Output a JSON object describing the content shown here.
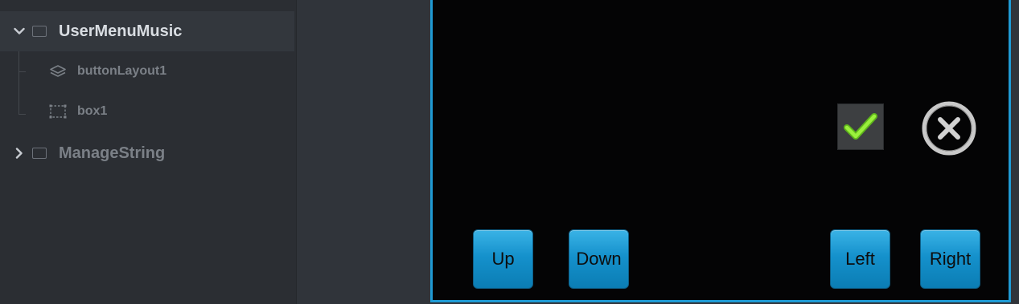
{
  "tree": {
    "items": [
      {
        "label": "UserMenuMusic",
        "expanded": true,
        "selected": true,
        "icon": "chevron-down-icon"
      },
      {
        "label": "buttonLayout1",
        "icon": "layers-icon"
      },
      {
        "label": "box1",
        "icon": "box-select-icon"
      },
      {
        "label": "ManageString",
        "expanded": false,
        "icon": "chevron-right-icon"
      }
    ]
  },
  "preview": {
    "check_icon": "checkmark-icon",
    "close_icon": "close-circle-icon",
    "buttons": {
      "up": "Up",
      "down": "Down",
      "left": "Left",
      "right": "Right"
    }
  },
  "colors": {
    "panel_bg": "#2b2e33",
    "selection_bg": "#33373d",
    "preview_border": "#1f9ad4",
    "button_blue": "#1591cc",
    "check_green": "#8ee033"
  }
}
